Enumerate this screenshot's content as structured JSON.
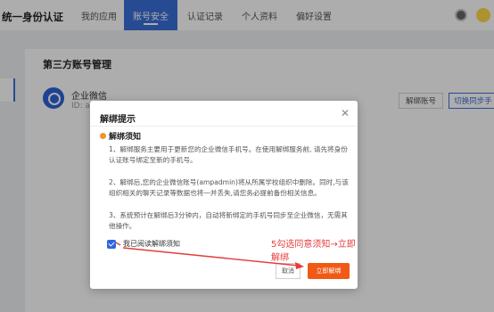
{
  "header": {
    "brand": "统一身份认证",
    "tabs": [
      {
        "label": "我的应用"
      },
      {
        "label": "账号安全"
      },
      {
        "label": "认证记录"
      },
      {
        "label": "个人资料"
      },
      {
        "label": "偏好设置"
      }
    ]
  },
  "page": {
    "section_title": "第三方账号管理",
    "account": {
      "name": "企业微信",
      "id_prefix": "ID: a",
      "unbind_label": "解绑账号",
      "switch_label": "切换同步手"
    }
  },
  "dialog": {
    "title": "解绑提示",
    "subtitle": "解绑须知",
    "paragraphs": [
      "1、解绑服务主要用于更新您的企业微信手机号。在使用解绑服务前, 请先将身份认证账号绑定至新的手机号。",
      "2、解绑后,您的企业微信账号(ampadmin)将从所属学校组织中删除。同时,与该组织相关的聊天记录等数据也将一并丢失,请您务必提前备份相关信息。",
      "3、系统预计在解绑后3分钟内，自动将新绑定的手机号同步至企业微信，无需其他操作。"
    ],
    "checkbox_label": "我已阅读解绑须知",
    "cancel_label": "取消",
    "confirm_label": "立即解绑"
  },
  "annotation": {
    "text": "5勾选同意须知→立即解绑",
    "color": "#e53b3b"
  },
  "colors": {
    "primary": "#3a6fd8",
    "confirm": "#f05a14",
    "notice_dot": "#f0932b"
  }
}
